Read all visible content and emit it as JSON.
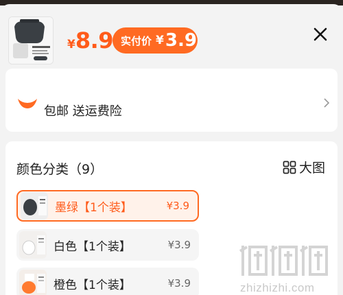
{
  "header": {
    "price_currency": "¥",
    "price": "8.9",
    "pay_label": "实付价",
    "pay_currency": "¥",
    "pay_price": "3.9"
  },
  "shipping": {
    "text": "包邮 送运费险"
  },
  "variants": {
    "title": "颜色分类（9）",
    "big_picture_label": "大图",
    "options": [
      {
        "name": "墨绿【1个装】",
        "price": "¥3.9",
        "selected": true
      },
      {
        "name": "白色【1个装】",
        "price": "¥3.9",
        "selected": false
      },
      {
        "name": "橙色【1个装】",
        "price": "¥3.9",
        "selected": false
      }
    ]
  },
  "watermark": {
    "text": "zhizhizhi.com"
  },
  "colors": {
    "accent": "#ff6a22",
    "price": "#ff5b1a"
  }
}
